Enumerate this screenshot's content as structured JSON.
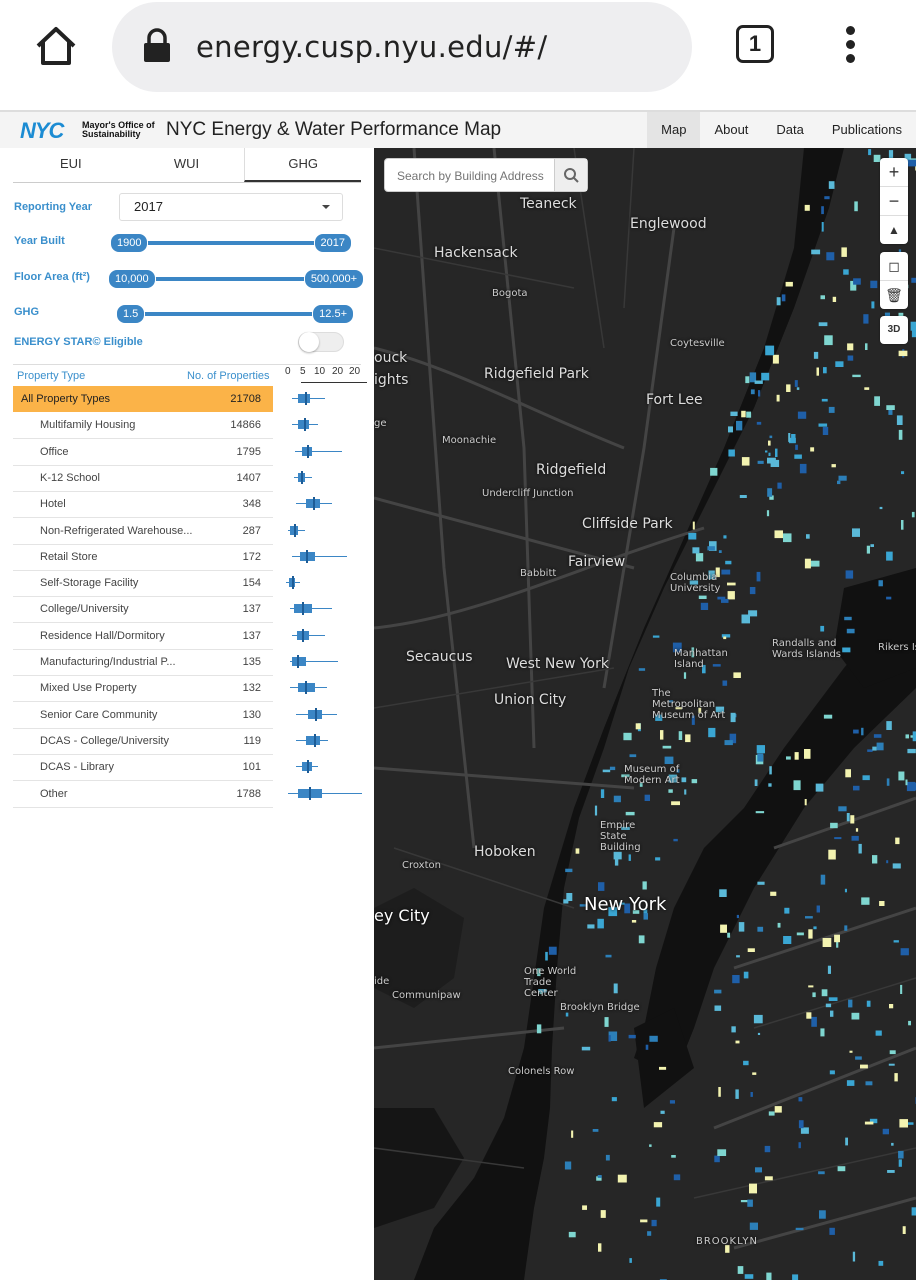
{
  "browser": {
    "url": "energy.cusp.nyu.edu/#/",
    "tab_count": "1"
  },
  "header": {
    "logo": "NYC",
    "logo_text": "Mayor's Office of Sustainability",
    "title": "NYC Energy & Water Performance Map",
    "nav": [
      "Map",
      "About",
      "Data",
      "Publications"
    ]
  },
  "sidebar": {
    "metric_tabs": [
      "EUI",
      "WUI",
      "GHG"
    ],
    "active_tab": "GHG",
    "reporting_year_label": "Reporting Year",
    "reporting_year": "2017",
    "year_built_label": "Year Built",
    "year_built_min": "1900",
    "year_built_max": "2017",
    "floor_area_label": "Floor Area (ft²)",
    "floor_area_min": "10,000",
    "floor_area_max": "500,000+",
    "ghg_label": "GHG",
    "ghg_min": "1.5",
    "ghg_max": "12.5+",
    "energy_star_label": "ENERGY STAR© Eligible",
    "energy_star_on": false,
    "table_header_type": "Property Type",
    "table_header_count": "No. of Properties",
    "axis_ticks": [
      "0",
      "5",
      "10",
      "20",
      "20"
    ],
    "rows": [
      {
        "name": "All Property Types",
        "count": "21708",
        "selected": true
      },
      {
        "name": "Multifamily Housing",
        "count": "14866"
      },
      {
        "name": "Office",
        "count": "1795"
      },
      {
        "name": "K-12 School",
        "count": "1407"
      },
      {
        "name": "Hotel",
        "count": "348"
      },
      {
        "name": "Non-Refrigerated Warehouse...",
        "count": "287"
      },
      {
        "name": "Retail Store",
        "count": "172"
      },
      {
        "name": "Self-Storage Facility",
        "count": "154"
      },
      {
        "name": "College/University",
        "count": "137"
      },
      {
        "name": "Residence Hall/Dormitory",
        "count": "137"
      },
      {
        "name": "Manufacturing/Industrial P...",
        "count": "135"
      },
      {
        "name": "Mixed Use Property",
        "count": "132"
      },
      {
        "name": "Senior Care Community",
        "count": "130"
      },
      {
        "name": "DCAS - College/University",
        "count": "119"
      },
      {
        "name": "DCAS - Library",
        "count": "101"
      },
      {
        "name": "Other",
        "count": "1788"
      }
    ]
  },
  "map": {
    "search_placeholder": "Search by Building Address",
    "button_3d": "3D",
    "labels": {
      "teaneck": "Teaneck",
      "englewood": "Englewood",
      "hackensack": "Hackensack",
      "bogota": "Bogota",
      "coytesville": "Coytesville",
      "ridgefield_park": "Ridgefield Park",
      "fort_lee": "Fort Lee",
      "moonachie": "Moonachie",
      "ridgefield": "Ridgefield",
      "undercliff": "Undercliff Junction",
      "cliffside": "Cliffside Park",
      "fairview": "Fairview",
      "babbitt": "Babbitt",
      "columbia": "Columbia University",
      "randalls": "Randalls and Wards Islands",
      "rikers": "Rikers Is",
      "secaucus": "Secaucus",
      "west_new_york": "West New York",
      "manhattan_island": "Manhattan Island",
      "union_city": "Union City",
      "met": "The Metropolitan Museum of Art",
      "moma": "Museum of Modern Art",
      "empire": "Empire State Building",
      "hoboken": "Hoboken",
      "croxton": "Croxton",
      "jersey_city": "ey City",
      "new_york": "New York",
      "wtc": "One World Trade Center",
      "communipaw": "Communipaw",
      "brooklyn_bridge": "Brooklyn Bridge",
      "colonels_row": "Colonels Row",
      "brooklyn": "BROOKLYN",
      "ouck": "ouck",
      "ights": "ights",
      "ge": "ge",
      "ide": "ide"
    },
    "legend_colors": {
      "low": "#1f5fa8",
      "mid": "#3aa6d3",
      "high": "#7fd6d0",
      "highest": "#f3f3b0"
    }
  }
}
